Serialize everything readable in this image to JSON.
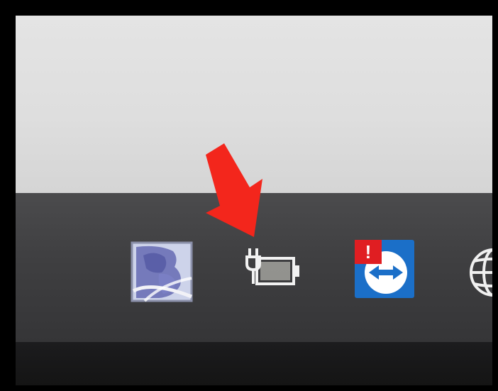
{
  "screen": {
    "window_background": "#e0e0e0",
    "taskbar_color": "#3f3f41"
  },
  "tray": {
    "icons": [
      {
        "name": "network-globe-app-icon",
        "clickable": true
      },
      {
        "name": "battery-plugged-in-icon",
        "clickable": true
      },
      {
        "name": "teamviewer-alert-icon",
        "clickable": true
      },
      {
        "name": "language-globe-icon",
        "clickable": true
      }
    ],
    "alert_badge": {
      "text": "!",
      "color": "#e01e22"
    },
    "teamviewer_color": "#1b6fc8"
  },
  "annotation": {
    "type": "arrow",
    "color": "#f3261c",
    "points_to": "battery-plugged-in-icon"
  }
}
